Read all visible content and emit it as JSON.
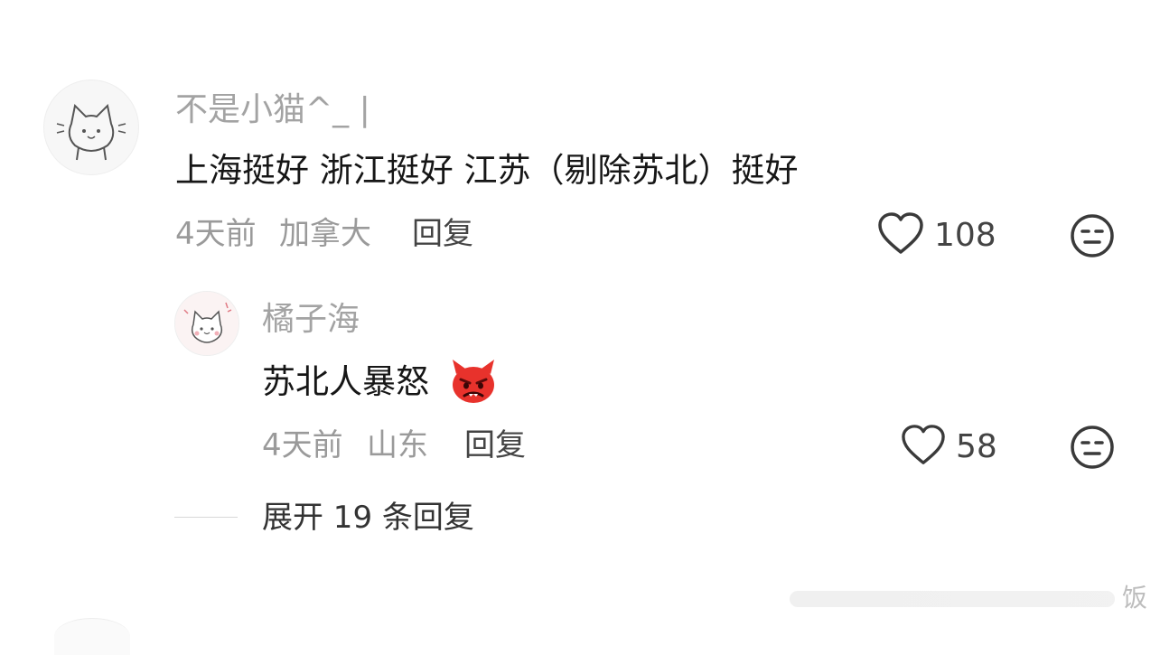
{
  "comment": {
    "username": "不是小猫^_ |",
    "content": "上海挺好 浙江挺好 江苏（剔除苏北）挺好",
    "time": "4天前",
    "location": "加拿大",
    "reply_label": "回复",
    "likes": "108",
    "avatar_icon": "cat-doodle-avatar",
    "like_icon": "heart-outline-icon",
    "dislike_icon": "neutral-face-icon"
  },
  "reply": {
    "username": "橘子海",
    "content": "苏北人暴怒",
    "emoji": "angry-devil-emoji",
    "time": "4天前",
    "location": "山东",
    "reply_label": "回复",
    "likes": "58",
    "avatar_icon": "cat-doodle-avatar-pink",
    "like_icon": "heart-outline-icon",
    "dislike_icon": "neutral-face-icon"
  },
  "expand_label": "展开 19 条回复",
  "watermark_text": "饭",
  "colors": {
    "emoji_red": "#e8322c",
    "muted_text": "#a3a3a3",
    "icon_gray": "#3a3a3a"
  }
}
